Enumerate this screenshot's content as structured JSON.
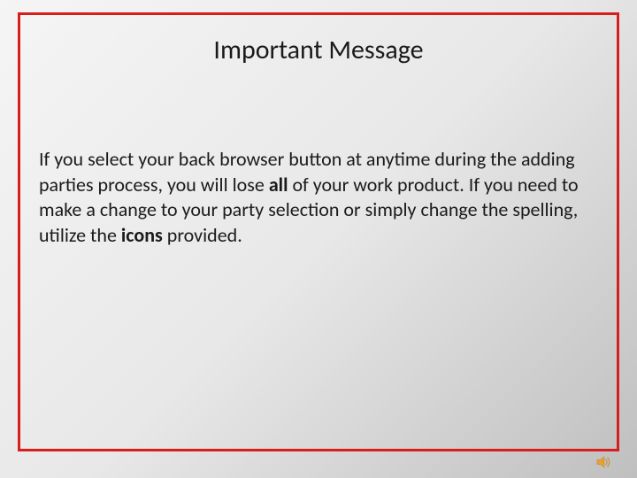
{
  "title": "Important Message",
  "body": {
    "part1": "If you select your back browser button at anytime during the adding parties process, you will lose ",
    "bold1": "all",
    "part2": " of your work product.  If you need to make a change to your party selection or simply change the spelling, utilize the ",
    "bold2": "icons",
    "part3": " provided."
  }
}
